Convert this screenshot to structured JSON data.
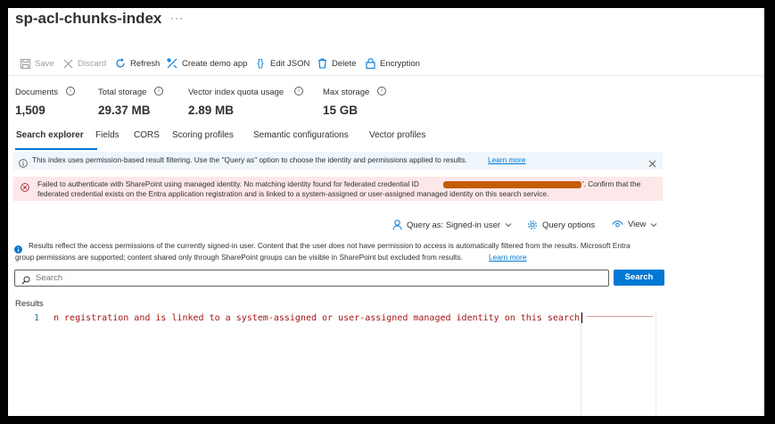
{
  "header": {
    "title": "sp-acl-chunks-index",
    "more": "···"
  },
  "toolbar": {
    "save": "Save",
    "discard": "Discard",
    "refresh": "Refresh",
    "create_demo_app": "Create demo app",
    "edit_json": "Edit JSON",
    "delete": "Delete",
    "encryption": "Encryption"
  },
  "metrics": [
    {
      "label": "Documents",
      "value": "1,509"
    },
    {
      "label": "Total storage",
      "value": "29.37 MB"
    },
    {
      "label": "Vector index quota usage",
      "value": "2.89 MB"
    },
    {
      "label": "Max storage",
      "value": "15 GB"
    }
  ],
  "tabs": [
    "Search explorer",
    "Fields",
    "CORS",
    "Scoring profiles",
    "Semantic configurations",
    "Vector profiles"
  ],
  "info_banner": {
    "text": "This index uses permission-based result filtering. Use the \"Query as\" option to choose the identity and permissions applied to results.",
    "link": "Learn more"
  },
  "error_banner": {
    "line1_pre": "Failed to authenticate with SharePoint using managed identity. No matching identity found for federated credential ID",
    "line1_post": "'. Confirm that the",
    "line2": "federated credential exists on the Entra application registration and is linked to a system-assigned or user-assigned managed identity on this search service."
  },
  "query_options": {
    "query_as": "Query as: Signed-in user",
    "query_options": "Query options",
    "view": "View"
  },
  "permission_note": {
    "line1": "Results reflect the access permissions of the currently signed-in user. Content that the user does not have permission to access is automatically filtered from the results. Microsoft Entra",
    "line2": "group permissions are supported; content shared only through SharePoint groups can be visible in SharePoint but excluded from results.",
    "link": "Learn more"
  },
  "search": {
    "placeholder": "Search",
    "button": "Search"
  },
  "results": {
    "label": "Results",
    "line_number": "1",
    "line_text": "n registration and is linked to a system-assigned or user-assigned managed identity on this search service.\""
  },
  "colors": {
    "accent": "#0078d4",
    "error": "#a4262c",
    "redaction": "#c45c00"
  }
}
